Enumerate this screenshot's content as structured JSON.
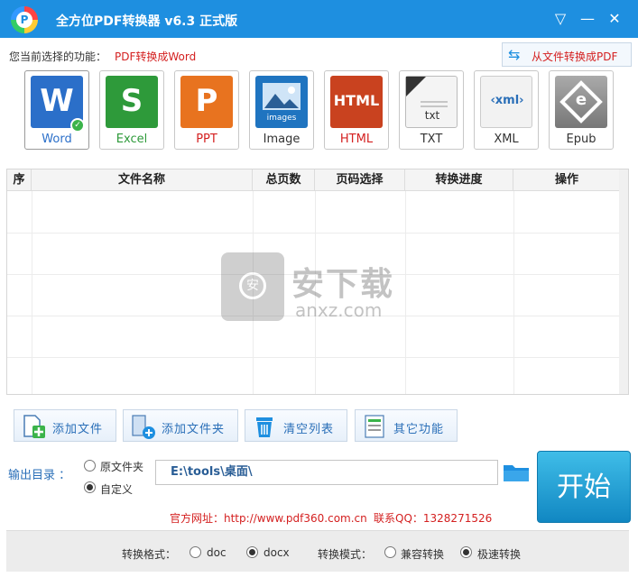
{
  "window": {
    "title": "全方位PDF转换器 v6.3 正式版",
    "logo_letter": "P",
    "min_icon": "▽",
    "menu_icon": "—",
    "close_icon": "✕"
  },
  "function": {
    "label": "您当前选择的功能：",
    "value": "PDF转换成Word",
    "to_pdf_label": "从文件转换成PDF",
    "to_pdf_icon": "⇆"
  },
  "formats": [
    {
      "label": "Word",
      "tile": "W",
      "color": "#2b6fc9",
      "selected": true
    },
    {
      "label": "Excel",
      "tile": "S",
      "color": "#2e9a3a",
      "selected": false
    },
    {
      "label": "PPT",
      "tile": "P",
      "color": "#e8731f",
      "selected": false
    },
    {
      "label": "Image",
      "tile": "images",
      "color": "#1f74c0",
      "selected": false
    },
    {
      "label": "HTML",
      "tile": "HTML",
      "color": "#c9421f",
      "selected": false
    },
    {
      "label": "TXT",
      "tile": "txt",
      "color": "#e8e8e8",
      "selected": false
    },
    {
      "label": "XML",
      "tile": "‹xml›",
      "color": "#f2f2f2",
      "selected": false
    },
    {
      "label": "Epub",
      "tile": "e",
      "color": "#8a8a8a",
      "selected": false
    }
  ],
  "table": {
    "headers": [
      "序",
      "文件名称",
      "总页数",
      "页码选择",
      "转换进度",
      "操作"
    ]
  },
  "watermark": {
    "cn": "安下载",
    "en": "anxz.com",
    "shield_char": "安"
  },
  "actions": {
    "add_file": "添加文件",
    "add_folder": "添加文件夹",
    "clear_list": "清空列表",
    "other": "其它功能"
  },
  "output": {
    "label": "输出目录 ：",
    "option_original": "原文件夹",
    "option_custom": "自定义",
    "path": "E:\\tools\\桌面\\",
    "start": "开始"
  },
  "info": {
    "site": "官方网址：http://www.pdf360.com.cn",
    "qq": "联系QQ：1328271526"
  },
  "footer": {
    "format_label": "转换格式：",
    "doc": "doc",
    "docx": "docx",
    "mode_label": "转换模式：",
    "compat": "兼容转换",
    "fast": "极速转换"
  }
}
